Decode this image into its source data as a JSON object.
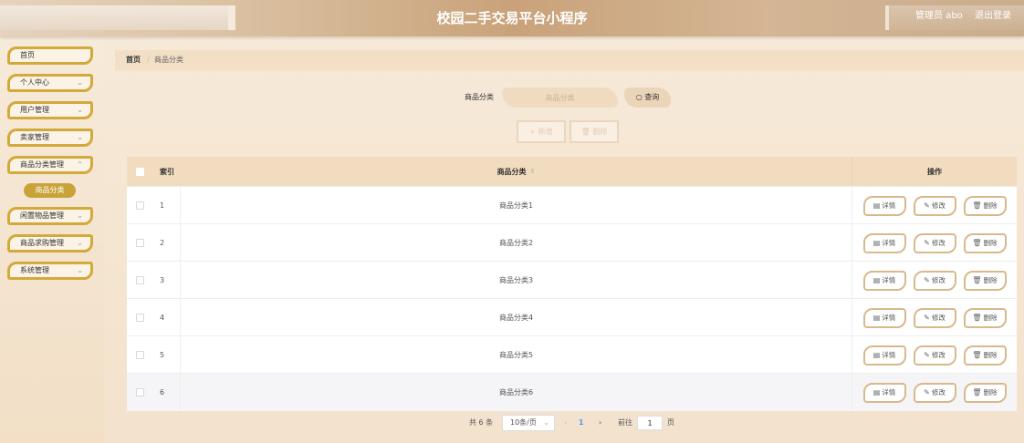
{
  "header": {
    "title": "校园二手交易平台小程序",
    "user": "管理员 abo",
    "logout": "退出登录"
  },
  "sidebar": {
    "items": [
      {
        "label": "首页",
        "chevron": false
      },
      {
        "label": "个人中心",
        "chevron": true
      },
      {
        "label": "用户管理",
        "chevron": true
      },
      {
        "label": "卖家管理",
        "chevron": true
      },
      {
        "label": "商品分类管理",
        "chevron": true
      },
      {
        "label": "闲置物品管理",
        "chevron": true
      },
      {
        "label": "商品求购管理",
        "chevron": true
      },
      {
        "label": "系统管理",
        "chevron": true
      }
    ],
    "active_sub": "商品分类"
  },
  "breadcrumb": {
    "home": "首页",
    "separator": "/",
    "current": "商品分类"
  },
  "search": {
    "label": "商品分类",
    "placeholder": "商品分类",
    "query_label": "查询",
    "query_icon": "search-icon"
  },
  "actions": {
    "add_label": "新增",
    "delete_label": "删除"
  },
  "table": {
    "headers": {
      "index": "索引",
      "name": "商品分类",
      "ops": "操作"
    },
    "rows": [
      {
        "index": "1",
        "name": "商品分类1"
      },
      {
        "index": "2",
        "name": "商品分类2"
      },
      {
        "index": "3",
        "name": "商品分类3"
      },
      {
        "index": "4",
        "name": "商品分类4"
      },
      {
        "index": "5",
        "name": "商品分类5"
      },
      {
        "index": "6",
        "name": "商品分类6"
      }
    ],
    "row_actions": {
      "detail": "详情",
      "edit": "修改",
      "delete": "删除"
    }
  },
  "pagination": {
    "total": "共 6 条",
    "page_size": "10条/页",
    "current": "1",
    "goto": "前往",
    "goto_value": "1",
    "page_suffix": "页"
  },
  "colors": {
    "accent": "#d3a93b",
    "header_bg": "#f2dcbf",
    "button_border": "#d8b98c"
  }
}
